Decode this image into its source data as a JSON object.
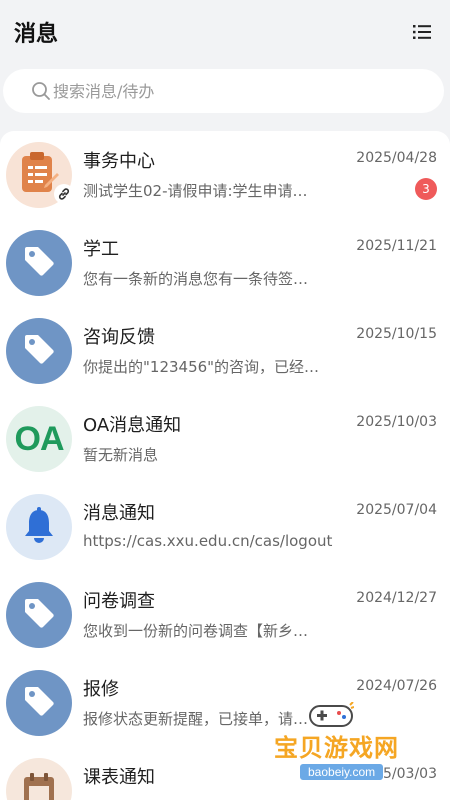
{
  "header": {
    "title": "消息"
  },
  "search": {
    "placeholder": "搜索消息/待办"
  },
  "messages": [
    {
      "name": "事务中心",
      "date": "2025/04/28",
      "preview": "测试学生02-请假申请:学生申请…",
      "badge": "3",
      "icon": "clipboard-icon"
    },
    {
      "name": "学工",
      "date": "2025/11/21",
      "preview": "您有一条新的消息您有一条待签…",
      "icon": "tag-icon"
    },
    {
      "name": "咨询反馈",
      "date": "2025/10/15",
      "preview": "你提出的\"123456\"的咨询，已经…",
      "icon": "tag-icon"
    },
    {
      "name": "OA消息通知",
      "date": "2025/10/03",
      "preview": "暂无新消息",
      "icon": "oa-icon",
      "avatar_text": "OA"
    },
    {
      "name": "消息通知",
      "date": "2025/07/04",
      "preview": "https://cas.xxu.edu.cn/cas/logout",
      "icon": "bell-icon"
    },
    {
      "name": "问卷调查",
      "date": "2024/12/27",
      "preview": "您收到一份新的问卷调查【新乡…",
      "icon": "tag-icon"
    },
    {
      "name": "报修",
      "date": "2024/07/26",
      "preview": "报修状态更新提醒，已接单，请…",
      "icon": "tag-icon"
    },
    {
      "name": "课表通知",
      "date": "2025/03/03",
      "preview": "",
      "icon": "calendar-icon"
    }
  ],
  "watermark": {
    "title": "宝贝游戏网",
    "url": "baobeiy.com"
  },
  "colors": {
    "tag_avatar": "#6f95c5",
    "badge": "#ef5a5a",
    "oa_green": "#1f9a5c",
    "watermark_orange": "#f5a623"
  }
}
